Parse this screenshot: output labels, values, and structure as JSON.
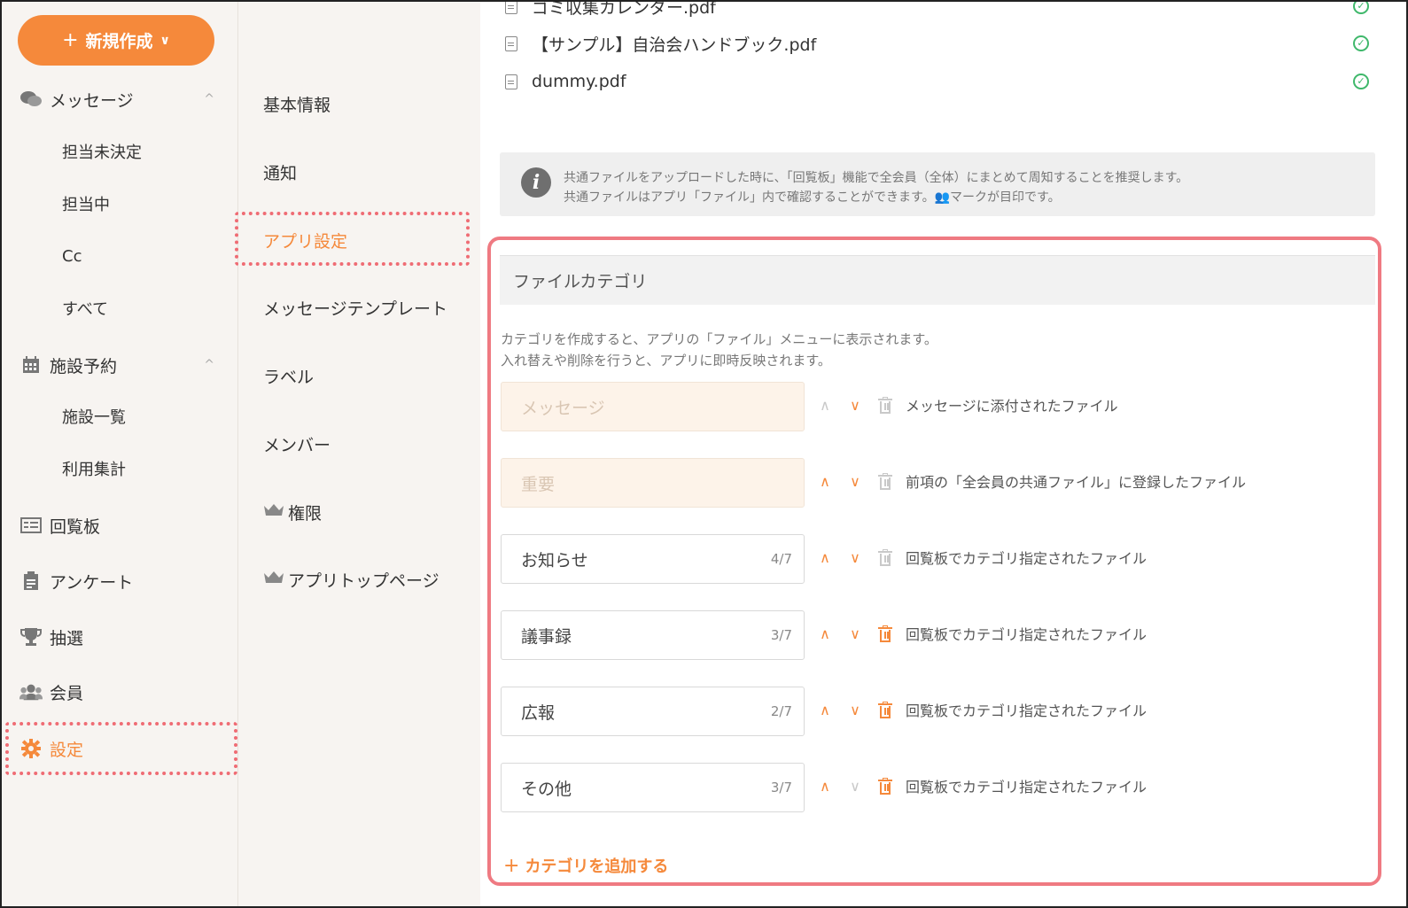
{
  "left_nav": {
    "new_button": {
      "plus": "+",
      "label": "新規作成",
      "chevron": "∨"
    },
    "messages": {
      "label": "メッセージ",
      "caret": "^"
    },
    "message_sub": [
      "担当未決定",
      "担当中",
      "Cc",
      "すべて"
    ],
    "facility": {
      "label": "施設予約",
      "caret": "^"
    },
    "facility_sub": [
      "施設一覧",
      "利用集計"
    ],
    "circular": {
      "label": "回覧板"
    },
    "survey": {
      "label": "アンケート"
    },
    "lottery": {
      "label": "抽選"
    },
    "members": {
      "label": "会員"
    },
    "settings": {
      "label": "設定"
    }
  },
  "mid_nav": {
    "items": [
      "基本情報",
      "通知",
      "アプリ設定",
      "メッセージテンプレート",
      "ラベル",
      "メンバー",
      "権限",
      "アプリトップページ"
    ]
  },
  "files": [
    {
      "name": "ゴミ収集カレンダー.pdf",
      "status": "✓"
    },
    {
      "name": "【サンプル】自治会ハンドブック.pdf",
      "status": "✓"
    },
    {
      "name": "dummy.pdf",
      "status": "✓"
    }
  ],
  "info": {
    "icon": "i",
    "line1": "共通ファイルをアップロードした時に、「回覧板」機能で全会員（全体）にまとめて周知することを推奨します。",
    "line2": "共通ファイルはアプリ「ファイル」内で確認することができます。👥マークが目印です。"
  },
  "category": {
    "title": "ファイルカテゴリ",
    "desc_line1": "カテゴリを作成すると、アプリの「ファイル」メニューに表示されます。",
    "desc_line2": "入れ替えや削除を行うと、アプリに即時反映されます。",
    "rows": [
      {
        "name": "メッセージ",
        "count": "",
        "note": "メッセージに添付されたファイル",
        "up": "∧",
        "down": "∨"
      },
      {
        "name": "重要",
        "count": "",
        "note": "前項の「全会員の共通ファイル」に登録したファイル",
        "up": "∧",
        "down": "∨"
      },
      {
        "name": "お知らせ",
        "count": "4/7",
        "note": "回覧板でカテゴリ指定されたファイル",
        "up": "∧",
        "down": "∨"
      },
      {
        "name": "議事録",
        "count": "3/7",
        "note": "回覧板でカテゴリ指定されたファイル",
        "up": "∧",
        "down": "∨"
      },
      {
        "name": "広報",
        "count": "2/7",
        "note": "回覧板でカテゴリ指定されたファイル",
        "up": "∧",
        "down": "∨"
      },
      {
        "name": "その他",
        "count": "3/7",
        "note": "回覧板でカテゴリ指定されたファイル",
        "up": "∧",
        "down": "∨"
      }
    ],
    "add_plus": "+",
    "add_label": "カテゴリを追加する"
  },
  "colors": {
    "accent": "#f5893b",
    "highlight": "#ef6c74",
    "success": "#3fb86b"
  }
}
